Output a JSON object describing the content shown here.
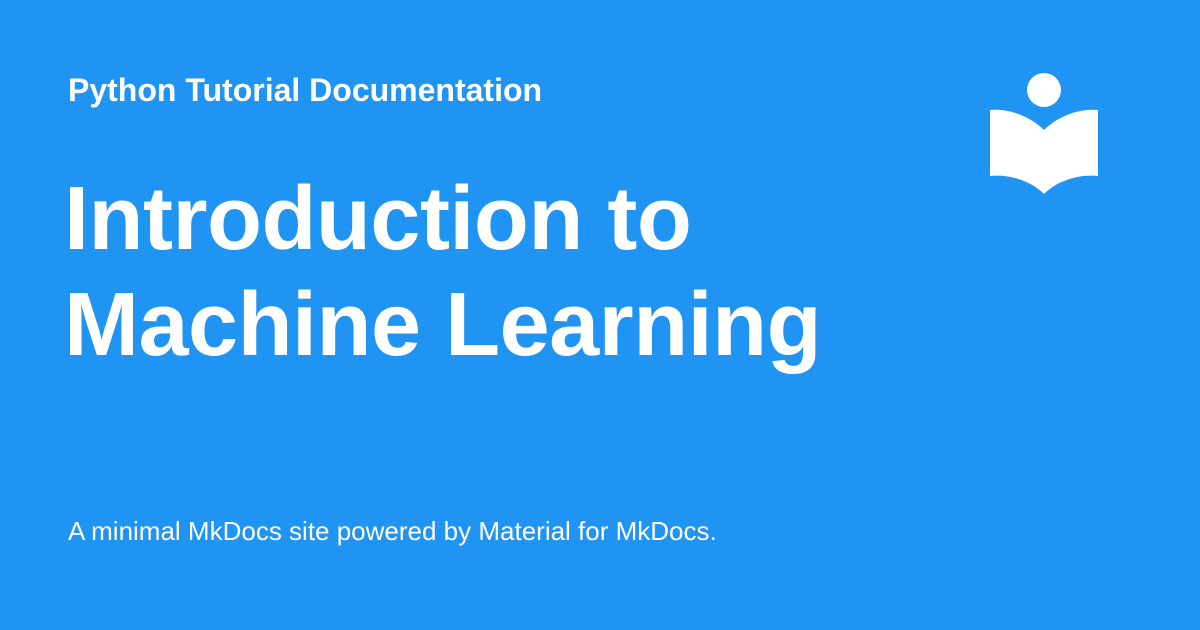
{
  "card": {
    "background_color": "#2094f3",
    "text_color": "#ffffff",
    "site_name": "Python Tutorial Documentation",
    "title_lines": [
      "Introduction to",
      "Machine Learning"
    ],
    "description": "A minimal MkDocs site powered by Material for MkDocs.",
    "logo_icon": "open-book-reader-icon"
  }
}
